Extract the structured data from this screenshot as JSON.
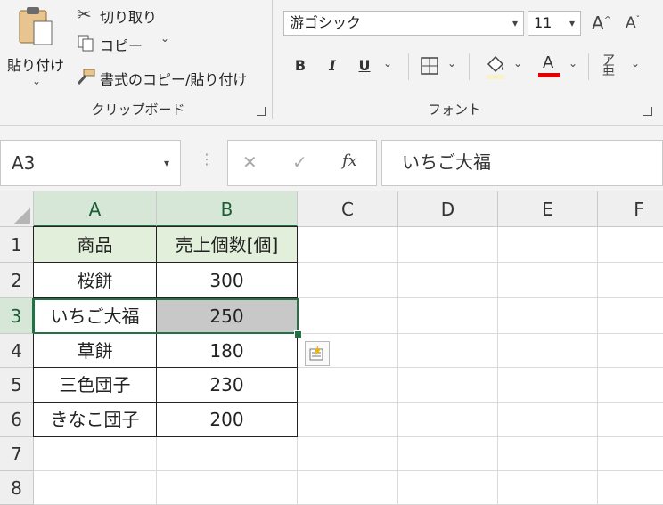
{
  "clipboard": {
    "paste_label": "貼り付け",
    "cut_label": "切り取り",
    "copy_label": "コピー",
    "format_painter_label": "書式のコピー/貼り付け",
    "group_label": "クリップボード"
  },
  "font_group": {
    "font_name": "游ゴシック",
    "font_size": "11",
    "bold": "B",
    "italic": "I",
    "underline": "U",
    "font_color_letter": "A",
    "group_label": "フォント"
  },
  "formula_bar": {
    "name_box": "A3",
    "formula": "いちご大福",
    "cancel": "✕",
    "enter": "✓",
    "fx": "fx"
  },
  "sheet": {
    "columns": [
      "A",
      "B",
      "C",
      "D",
      "E",
      "F"
    ],
    "rows": [
      "1",
      "2",
      "3",
      "4",
      "5",
      "6",
      "7",
      "8"
    ],
    "header": [
      "商品",
      "売上個数[個]"
    ],
    "data": [
      {
        "name": "桜餅",
        "qty": "300"
      },
      {
        "name": "いちご大福",
        "qty": "250"
      },
      {
        "name": "草餅",
        "qty": "180"
      },
      {
        "name": "三色団子",
        "qty": "230"
      },
      {
        "name": "きなこ団子",
        "qty": "200"
      }
    ]
  },
  "colors": {
    "accent": "#217346",
    "header_fill": "#e2efda",
    "selection_fill": "#c8c8c8",
    "font_color_bar": "#e00000"
  }
}
